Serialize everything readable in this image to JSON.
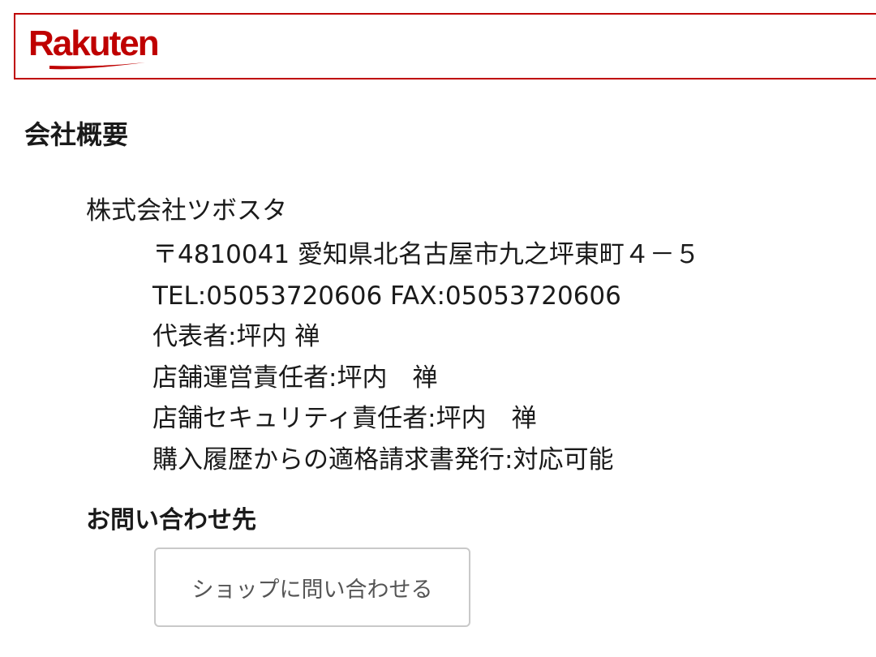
{
  "header": {
    "logo_text": "Rakuten",
    "brand_color": "#bf0000"
  },
  "company": {
    "section_title": "会社概要",
    "name": "株式会社ツボスタ",
    "details": [
      "〒4810041 愛知県北名古屋市九之坪東町４－５",
      "TEL:05053720606 FAX:05053720606",
      "代表者:坪内 禅",
      "店舗運営責任者:坪内　禅",
      "店舗セキュリティ責任者:坪内　禅",
      "購入履歴からの適格請求書発行:対応可能"
    ]
  },
  "contact": {
    "title": "お問い合わせ先",
    "button_label": "ショップに問い合わせる"
  }
}
